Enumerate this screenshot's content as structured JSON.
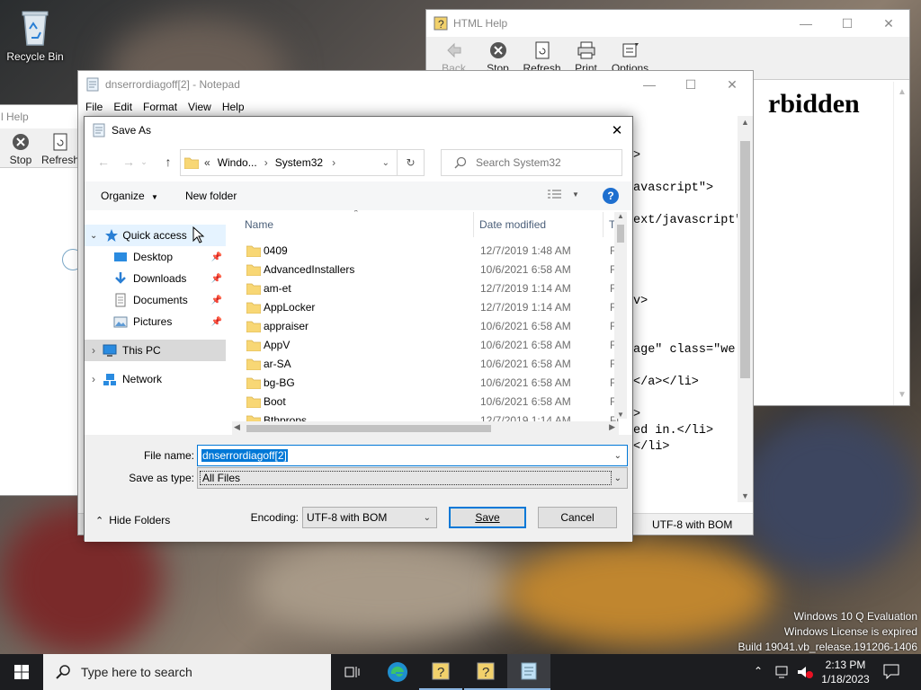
{
  "desktop": {
    "recycle_bin_label": "Recycle Bin",
    "watermark": [
      "Windows 10 Q Evaluation",
      "Windows License is expired",
      "Build 19041.vb_release.191206-1406"
    ]
  },
  "html_help_back": {
    "title": "l Help",
    "tools": [
      "Stop",
      "Refresh"
    ]
  },
  "html_help": {
    "title": "HTML Help",
    "tools": [
      "Back",
      "Stop",
      "Refresh",
      "Print",
      "Options"
    ],
    "content_heading": "rbidden"
  },
  "notepad": {
    "title": "dnserrordiagoff[2] - Notepad",
    "menu": [
      "File",
      "Edit",
      "Format",
      "View",
      "Help"
    ],
    "code_lines": [
      ">",
      "",
      "avascript\">",
      "",
      "ext/javascript\"",
      "",
      "",
      "",
      "",
      "v>",
      "",
      "",
      "age\" class=\"we",
      "",
      "</a></li>",
      "",
      ">",
      "ed in.</li>",
      "</li>"
    ],
    "status_encoding": "UTF-8 with BOM"
  },
  "save_as": {
    "title": "Save As",
    "breadcrumb": [
      "Windo...",
      "System32"
    ],
    "breadcrumb_prefix": "«",
    "search_placeholder": "Search System32",
    "organize_label": "Organize",
    "new_folder_label": "New folder",
    "nav": {
      "quick_access": "Quick access",
      "items": [
        "Desktop",
        "Downloads",
        "Documents",
        "Pictures"
      ],
      "this_pc": "This PC",
      "network": "Network"
    },
    "columns": {
      "name": "Name",
      "date": "Date modified",
      "type": "Ty"
    },
    "files": [
      {
        "name": "0409",
        "date": "12/7/2019 1:48 AM",
        "type": "Fi"
      },
      {
        "name": "AdvancedInstallers",
        "date": "10/6/2021 6:58 AM",
        "type": "Fi"
      },
      {
        "name": "am-et",
        "date": "12/7/2019 1:14 AM",
        "type": "Fi"
      },
      {
        "name": "AppLocker",
        "date": "12/7/2019 1:14 AM",
        "type": "Fi"
      },
      {
        "name": "appraiser",
        "date": "10/6/2021 6:58 AM",
        "type": "Fi"
      },
      {
        "name": "AppV",
        "date": "10/6/2021 6:58 AM",
        "type": "Fi"
      },
      {
        "name": "ar-SA",
        "date": "10/6/2021 6:58 AM",
        "type": "Fi"
      },
      {
        "name": "bg-BG",
        "date": "10/6/2021 6:58 AM",
        "type": "Fi"
      },
      {
        "name": "Boot",
        "date": "10/6/2021 6:58 AM",
        "type": "Fi"
      },
      {
        "name": "Bthprops",
        "date": "12/7/2019 1:14 AM",
        "type": "Fi"
      }
    ],
    "file_name_label": "File name:",
    "file_name_value": "dnserrordiagoff[2]",
    "save_as_type_label": "Save as type:",
    "save_as_type_value": "All Files",
    "hide_folders_label": "Hide Folders",
    "encoding_label": "Encoding:",
    "encoding_value": "UTF-8 with BOM",
    "save_label": "Save",
    "cancel_label": "Cancel"
  },
  "taskbar": {
    "search_placeholder": "Type here to search",
    "time": "2:13 PM",
    "date": "1/18/2023"
  },
  "colors": {
    "accent": "#0078d7",
    "selection": "#cce8ff",
    "folder": "#f8d775",
    "taskbar": "#1c1d20"
  }
}
